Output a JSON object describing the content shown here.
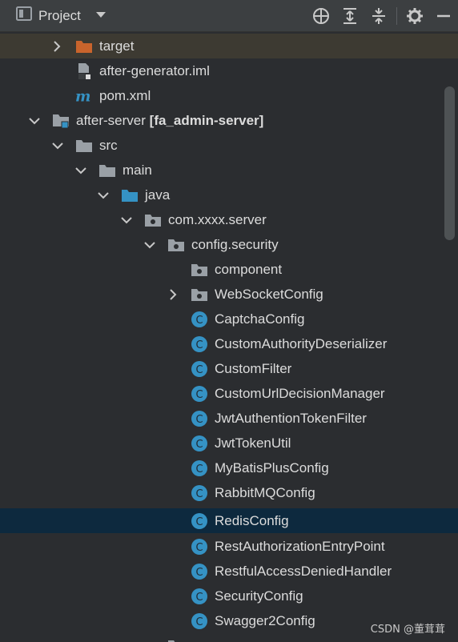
{
  "toolbar": {
    "title": "Project",
    "icons": [
      "project-view-icon",
      "caret-down-icon",
      "locate-icon",
      "expand-all-icon",
      "collapse-all-icon",
      "gear-icon",
      "minimize-icon"
    ]
  },
  "tree": {
    "target": "target",
    "after_generator_iml": "after-generator.iml",
    "pom_xml": "pom.xml",
    "after_server": "after-server",
    "after_server_module": "[fa_admin-server]",
    "src": "src",
    "main": "main",
    "java": "java",
    "pkg_server": "com.xxxx.server",
    "pkg_config_security": "config.security",
    "component": "component",
    "websocketconfig": "WebSocketConfig",
    "classes": [
      "CaptchaConfig",
      "CustomAuthorityDeserializer",
      "CustomFilter",
      "CustomUrlDecisionManager",
      "JwtAuthentionTokenFilter",
      "JwtTokenUtil",
      "MyBatisPlusConfig",
      "RabbitMQConfig",
      "RedisConfig",
      "RestAuthorizationEntryPoint",
      "RestfulAccessDeniedHandler",
      "SecurityConfig",
      "Swagger2Config"
    ],
    "selected": "RedisConfig"
  },
  "watermark": "CSDN @董茸茸",
  "colors": {
    "background": "#2b2d30",
    "toolbar": "#3c3f41",
    "selected_row": "#0d293e",
    "target_row": "#3d3a32",
    "folder_orange": "#c9642c",
    "folder_grey": "#9aa0a6",
    "folder_blue": "#3592c4",
    "class_icon": "#3592c4"
  }
}
